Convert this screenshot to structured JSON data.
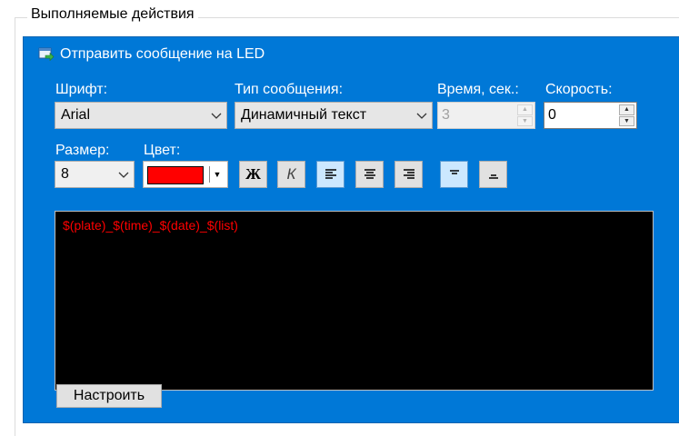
{
  "groupbox": {
    "title": "Выполняемые действия"
  },
  "panel": {
    "title": "Отправить сообщение на LED",
    "icon": "send-message-icon"
  },
  "font": {
    "label": "Шрифт:",
    "value": "Arial"
  },
  "message_type": {
    "label": "Тип сообщения:",
    "value": "Динамичный текст"
  },
  "time": {
    "label": "Время, сек.:",
    "value": "3"
  },
  "speed": {
    "label": "Скорость:",
    "value": "0"
  },
  "size": {
    "label": "Размер:",
    "value": "8"
  },
  "color": {
    "label": "Цвет:",
    "value": "#ff0000"
  },
  "format_buttons": {
    "bold_label": "Ж",
    "italic_label": "К"
  },
  "led": {
    "text": "$(plate)_$(time)_$(date)_$(list)",
    "text_color": "#ff0000",
    "background": "#000000"
  },
  "configure_button": {
    "label": "Настроить"
  },
  "colors": {
    "panel": "#0078d7",
    "active_button": "#cce8ff"
  }
}
